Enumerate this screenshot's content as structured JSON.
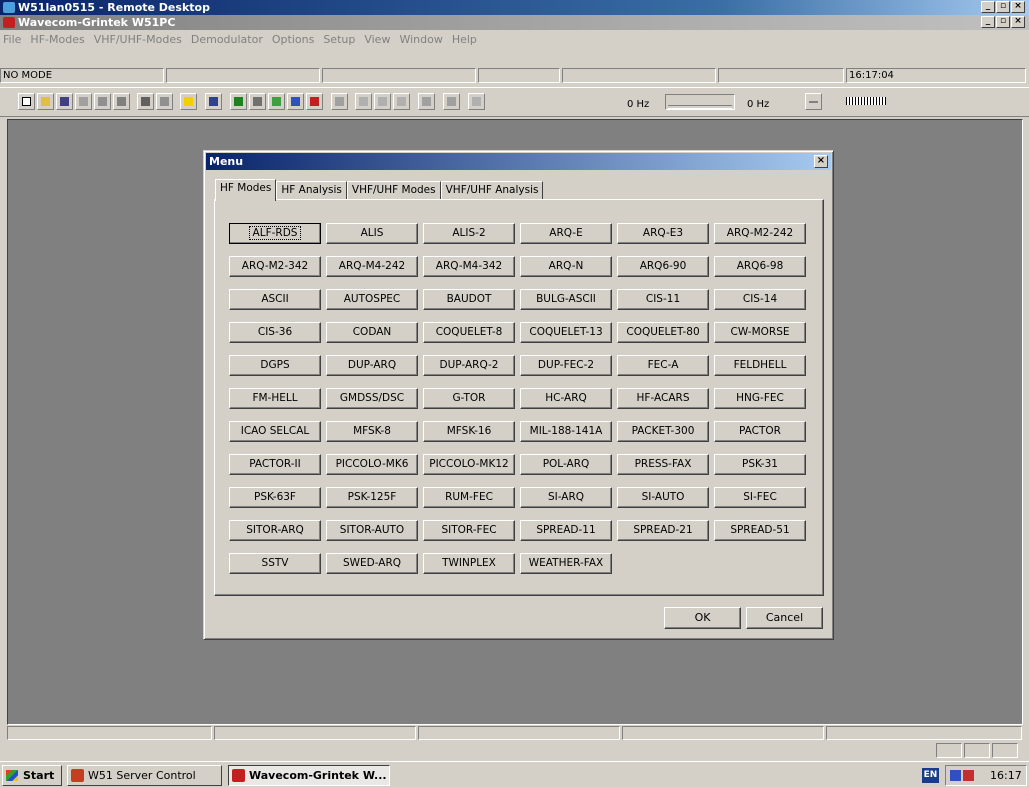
{
  "remote_window": {
    "title": "W51lan0515 - Remote Desktop"
  },
  "app_window": {
    "title": "Wavecom-Grintek W51PC"
  },
  "menubar": [
    "File",
    "HF-Modes",
    "VHF/UHF-Modes",
    "Demodulator",
    "Options",
    "Setup",
    "View",
    "Window",
    "Help"
  ],
  "status": {
    "mode": "NO MODE",
    "time": "16:17:04"
  },
  "toolbar": {
    "freq_left": "0 Hz",
    "freq_right": "0 Hz"
  },
  "dialog": {
    "title": "Menu",
    "tabs": [
      "HF Modes",
      "HF Analysis",
      "VHF/UHF Modes",
      "VHF/UHF Analysis"
    ],
    "active_tab": "HF Modes",
    "modes": [
      "ALF-RDS",
      "ALIS",
      "ALIS-2",
      "ARQ-E",
      "ARQ-E3",
      "ARQ-M2-242",
      "ARQ-M2-342",
      "ARQ-M4-242",
      "ARQ-M4-342",
      "ARQ-N",
      "ARQ6-90",
      "ARQ6-98",
      "ASCII",
      "AUTOSPEC",
      "BAUDOT",
      "BULG-ASCII",
      "CIS-11",
      "CIS-14",
      "CIS-36",
      "CODAN",
      "COQUELET-8",
      "COQUELET-13",
      "COQUELET-80",
      "CW-MORSE",
      "DGPS",
      "DUP-ARQ",
      "DUP-ARQ-2",
      "DUP-FEC-2",
      "FEC-A",
      "FELDHELL",
      "FM-HELL",
      "GMDSS/DSC",
      "G-TOR",
      "HC-ARQ",
      "HF-ACARS",
      "HNG-FEC",
      "ICAO SELCAL",
      "MFSK-8",
      "MFSK-16",
      "MIL-188-141A",
      "PACKET-300",
      "PACTOR",
      "PACTOR-II",
      "PICCOLO-MK6",
      "PICCOLO-MK12",
      "POL-ARQ",
      "PRESS-FAX",
      "PSK-31",
      "PSK-63F",
      "PSK-125F",
      "RUM-FEC",
      "SI-ARQ",
      "SI-AUTO",
      "SI-FEC",
      "SITOR-ARQ",
      "SITOR-AUTO",
      "SITOR-FEC",
      "SPREAD-11",
      "SPREAD-21",
      "SPREAD-51",
      "SSTV",
      "SWED-ARQ",
      "TWINPLEX",
      "WEATHER-FAX"
    ],
    "focused_mode": "ALF-RDS",
    "ok_label": "OK",
    "cancel_label": "Cancel"
  },
  "taskbar": {
    "start_label": "Start",
    "tasks": [
      "W51 Server Control",
      "Wavecom-Grintek W..."
    ],
    "active_task": "Wavecom-Grintek W...",
    "lang": "EN",
    "clock": "16:17"
  },
  "colors": {
    "title_active": "#0a246a",
    "desktop_gray": "#808080",
    "face": "#d4d0c8"
  }
}
